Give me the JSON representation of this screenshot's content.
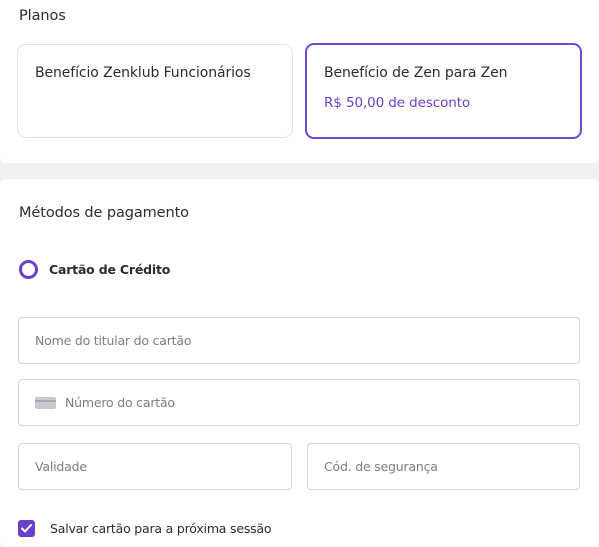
{
  "plans": {
    "title": "Planos",
    "options": [
      {
        "name": "Benefício Zenklub Funcionários",
        "discount": "",
        "selected": false
      },
      {
        "name": "Benefício de Zen para Zen",
        "discount": "R$ 50,00 de desconto",
        "selected": true
      }
    ]
  },
  "payment": {
    "title": "Métodos de pagamento",
    "method_label": "Cartão de Crédito",
    "fields": {
      "cardholder_placeholder": "Nome do titular do cartão",
      "card_number_placeholder": "Número do cartão",
      "expiry_placeholder": "Validade",
      "security_code_placeholder": "Cód. de segurança"
    },
    "save_card_label": "Salvar cartão para a próxima sessão",
    "save_card_checked": true
  },
  "colors": {
    "accent": "#6a3fcb",
    "selected_border": "#7547d4",
    "page_background": "#f0f0f2",
    "card_background": "#ffffff"
  },
  "icons": {
    "card_number": "credit-card-icon",
    "checkbox": "check-icon"
  }
}
